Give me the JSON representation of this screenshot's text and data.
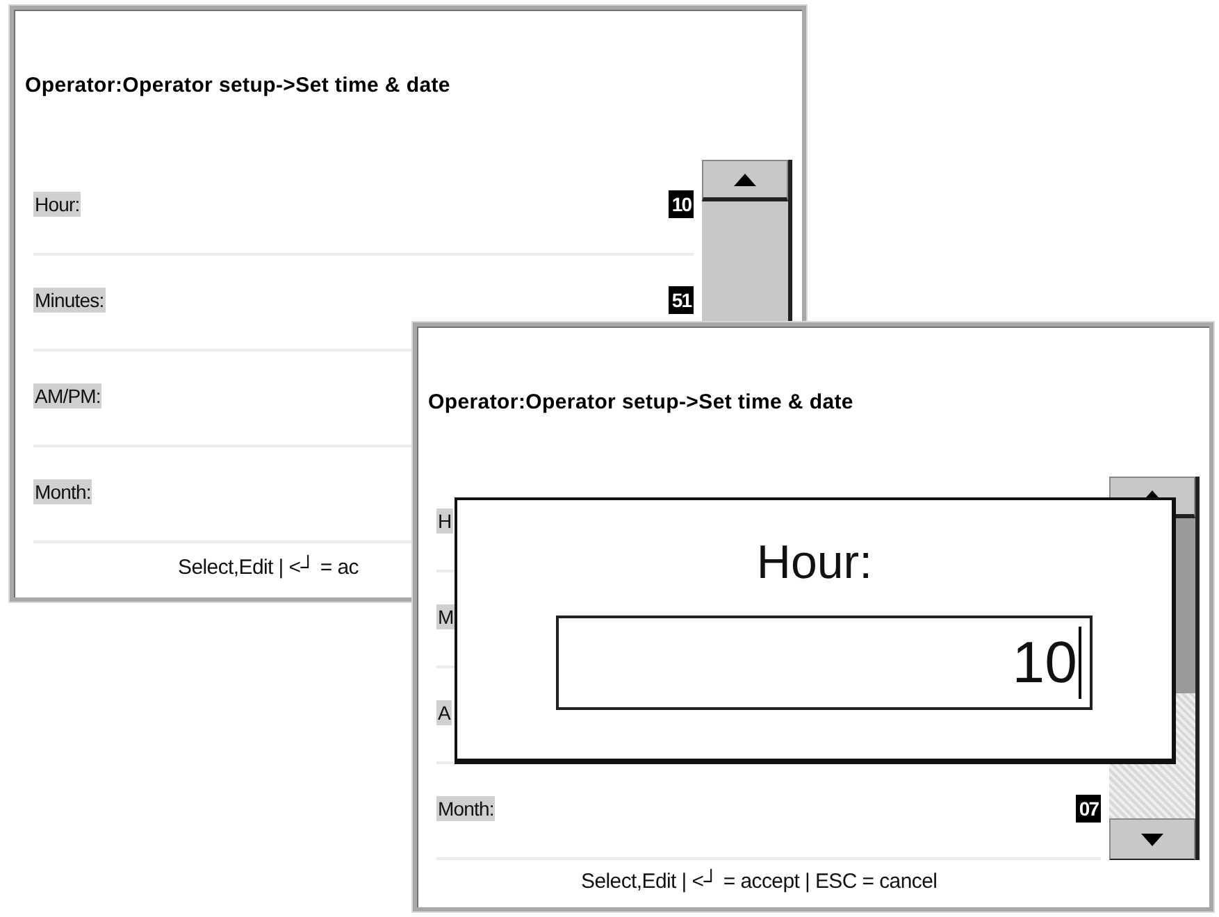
{
  "windows": [
    {
      "title": "Operator:Operator setup->Set time & date",
      "rows": [
        {
          "label": "Hour:",
          "value": "10"
        },
        {
          "label": "Minutes:",
          "value": "51"
        },
        {
          "label": "AM/PM:"
        },
        {
          "label": "Month:"
        }
      ],
      "footer": "Select,Edit | <┘ = ac"
    },
    {
      "title": "Operator:Operator setup->Set time & date",
      "rows": [
        {
          "label": "H"
        },
        {
          "label": "M"
        },
        {
          "label": "A"
        },
        {
          "label": "Month:",
          "value": "07"
        }
      ],
      "footer": "Select,Edit | <┘ = accept | ESC = cancel",
      "dialog": {
        "title": "Hour:",
        "value": "10"
      }
    }
  ]
}
